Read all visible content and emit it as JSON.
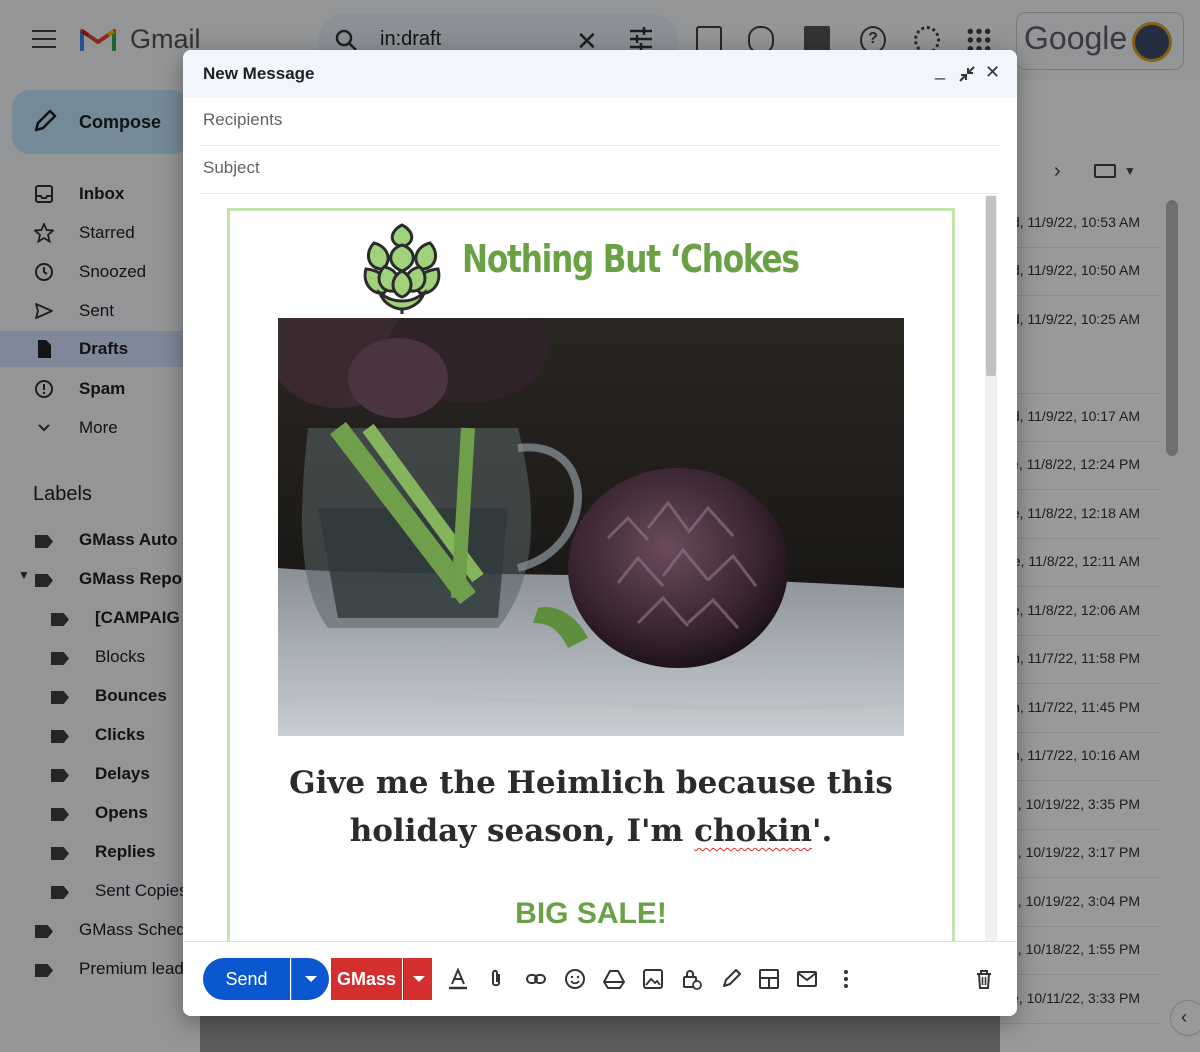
{
  "gmail": {
    "brand": "Gmail",
    "search_query": "in:draft",
    "google_word": "Google",
    "compose_label": "Compose",
    "nav": [
      {
        "label": "Inbox",
        "icon": "inbox-icon"
      },
      {
        "label": "Starred",
        "icon": "star-icon"
      },
      {
        "label": "Snoozed",
        "icon": "clock-icon"
      },
      {
        "label": "Sent",
        "icon": "send-icon"
      },
      {
        "label": "Drafts",
        "icon": "draft-icon"
      },
      {
        "label": "Spam",
        "icon": "spam-icon"
      },
      {
        "label": "More",
        "icon": "chevron-down-icon"
      }
    ],
    "labels_heading": "Labels",
    "labels": [
      {
        "text": "GMass Auto"
      },
      {
        "text": "GMass Repo"
      },
      {
        "text": "[CAMPAIG"
      },
      {
        "text": "Blocks"
      },
      {
        "text": "Bounces"
      },
      {
        "text": "Clicks"
      },
      {
        "text": "Delays"
      },
      {
        "text": "Opens"
      },
      {
        "text": "Replies"
      },
      {
        "text": "Sent Copies"
      },
      {
        "text": "GMass Sched"
      },
      {
        "text": "Premium lead"
      }
    ],
    "dates": [
      "d, 11/9/22, 10:53 AM",
      "d, 11/9/22, 10:50 AM",
      "d, 11/9/22, 10:25 AM",
      "d, 11/9/22, 10:17 AM",
      "e, 11/8/22, 12:24 PM",
      "e, 11/8/22, 12:18 AM",
      "ue, 11/8/22, 12:11 AM",
      "e, 11/8/22, 12:06 AM",
      "on, 11/7/22, 11:58 PM",
      "on, 11/7/22, 11:45 PM",
      "on, 11/7/22, 10:16 AM",
      "d, 10/19/22, 3:35 PM",
      "d, 10/19/22, 3:17 PM",
      ", 10/19/22, 3:04 PM",
      "e, 10/18/22, 1:55 PM",
      "e, 10/11/22, 3:33 PM"
    ]
  },
  "compose": {
    "title": "New Message",
    "recipients_placeholder": "Recipients",
    "subject_placeholder": "Subject",
    "brand_name": "Nothing But ‘Chokes",
    "headline_part1": "Give me the Heimlich because this holiday season, I'm ",
    "headline_misspelled": "chokin",
    "headline_part2": "'.",
    "sale_text": "BIG SALE!",
    "send_label": "Send",
    "gmass_label": "GMass"
  },
  "colors": {
    "brand_green": "#6aa145",
    "send_blue": "#0b57d0",
    "gmass_red": "#d32f2f",
    "card_border": "#c5e3b0"
  }
}
